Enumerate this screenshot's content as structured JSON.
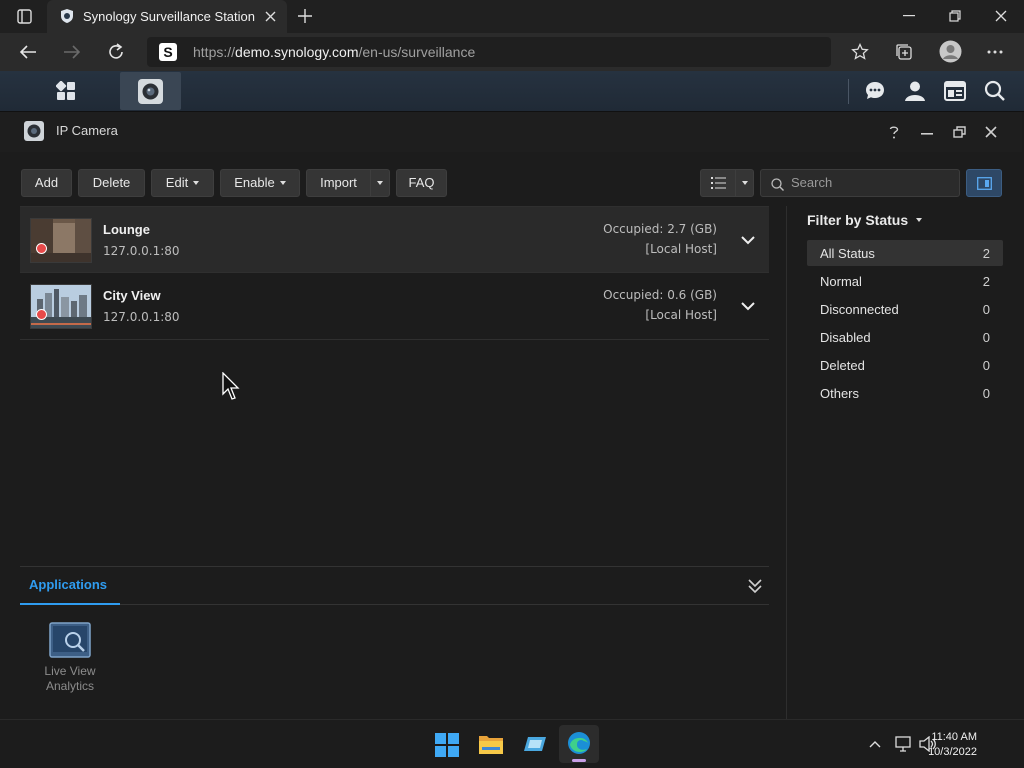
{
  "browser": {
    "tab_title": "Synology Surveillance Station - N",
    "url_prefix": "https://",
    "url_host": "demo.synology.com",
    "url_path": "/en-us/surveillance"
  },
  "window": {
    "title": "IP Camera"
  },
  "toolbar": {
    "add": "Add",
    "delete": "Delete",
    "edit": "Edit",
    "enable": "Enable",
    "import": "Import",
    "faq": "FAQ",
    "search_placeholder": "Search"
  },
  "cameras": [
    {
      "name": "Lounge",
      "address": "127.0.0.1:80",
      "occupied": "Occupied: 2.7 (GB)",
      "host": "[Local Host]"
    },
    {
      "name": "City View",
      "address": "127.0.0.1:80",
      "occupied": "Occupied: 0.6 (GB)",
      "host": "[Local Host]"
    }
  ],
  "filter": {
    "heading": "Filter by Status",
    "items": [
      {
        "label": "All Status",
        "count": "2"
      },
      {
        "label": "Normal",
        "count": "2"
      },
      {
        "label": "Disconnected",
        "count": "0"
      },
      {
        "label": "Disabled",
        "count": "0"
      },
      {
        "label": "Deleted",
        "count": "0"
      },
      {
        "label": "Others",
        "count": "0"
      }
    ]
  },
  "applications": {
    "tab": "Applications",
    "app_line1": "Live View",
    "app_line2": "Analytics"
  },
  "taskbar": {
    "time": "11:40 AM",
    "date": "10/3/2022"
  },
  "colors": {
    "accent": "#2f9cf0",
    "status_dot": "#e84a4a"
  }
}
